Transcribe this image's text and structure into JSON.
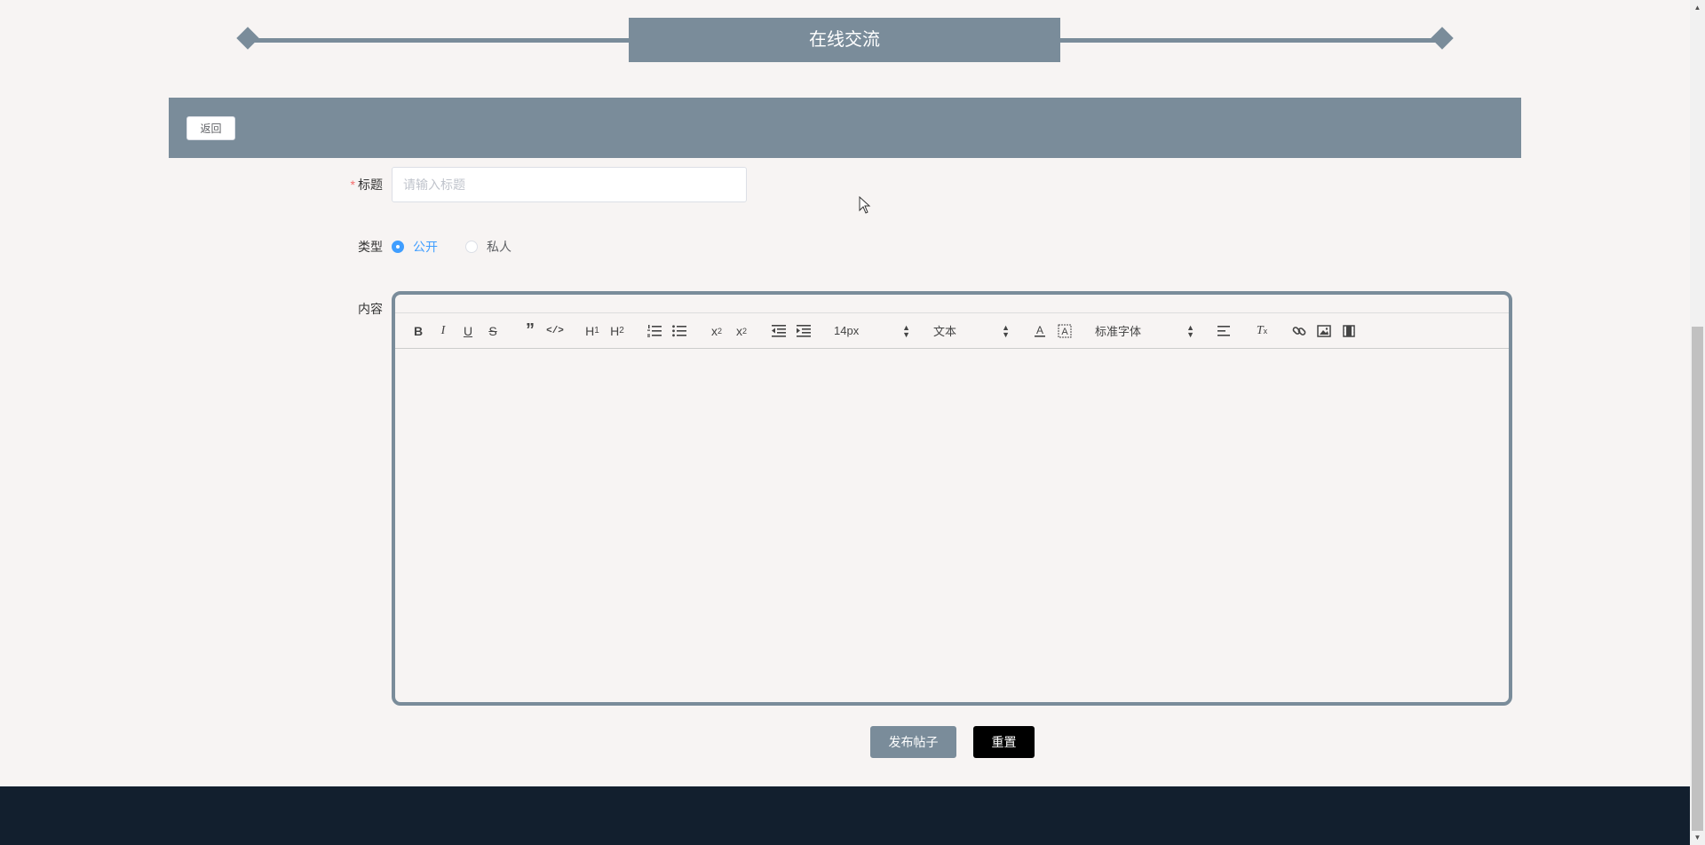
{
  "banner": {
    "title": "在线交流"
  },
  "header": {
    "back_label": "返回"
  },
  "form": {
    "title_label": "标题",
    "required_mark": "*",
    "title_placeholder": "请输入标题",
    "title_value": "",
    "type_label": "类型",
    "type_options": [
      {
        "label": "公开",
        "checked": true
      },
      {
        "label": "私人",
        "checked": false
      }
    ],
    "content_label": "内容"
  },
  "editor": {
    "toolbar": {
      "size_value": "14px",
      "header_value": "文本",
      "font_value": "标准字体"
    },
    "content": ""
  },
  "actions": {
    "submit_label": "发布帖子",
    "reset_label": "重置"
  },
  "colors": {
    "accent": "#7a8c9a",
    "page_bg": "#f7f4f3",
    "footer_bg": "#121f2e",
    "radio_active": "#409eff",
    "required": "#f56c6c"
  }
}
